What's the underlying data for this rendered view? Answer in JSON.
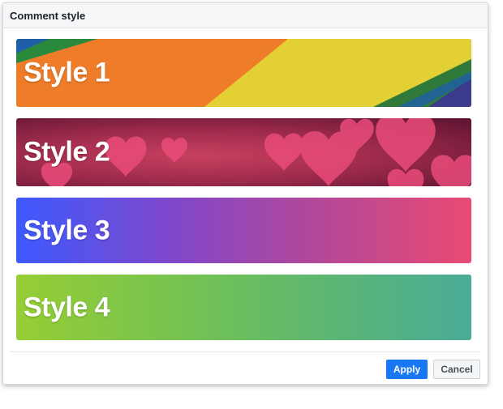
{
  "dialog": {
    "title": "Comment style"
  },
  "styles": [
    {
      "label": "Style 1",
      "background": "rainbow-stripes"
    },
    {
      "label": "Style 2",
      "background": "hearts"
    },
    {
      "label": "Style 3",
      "background": "blue-to-pink-gradient"
    },
    {
      "label": "Style 4",
      "background": "green-to-teal-gradient"
    }
  ],
  "footer": {
    "apply_label": "Apply",
    "cancel_label": "Cancel"
  },
  "colors": {
    "apply_button": "#1877f2",
    "cancel_button": "#f5f6f7",
    "header_bg": "#f5f6f7",
    "style3_start": "#3d5aff",
    "style3_end": "#e84a73",
    "style4_start": "#96ce34",
    "style4_end": "#4aab97"
  }
}
